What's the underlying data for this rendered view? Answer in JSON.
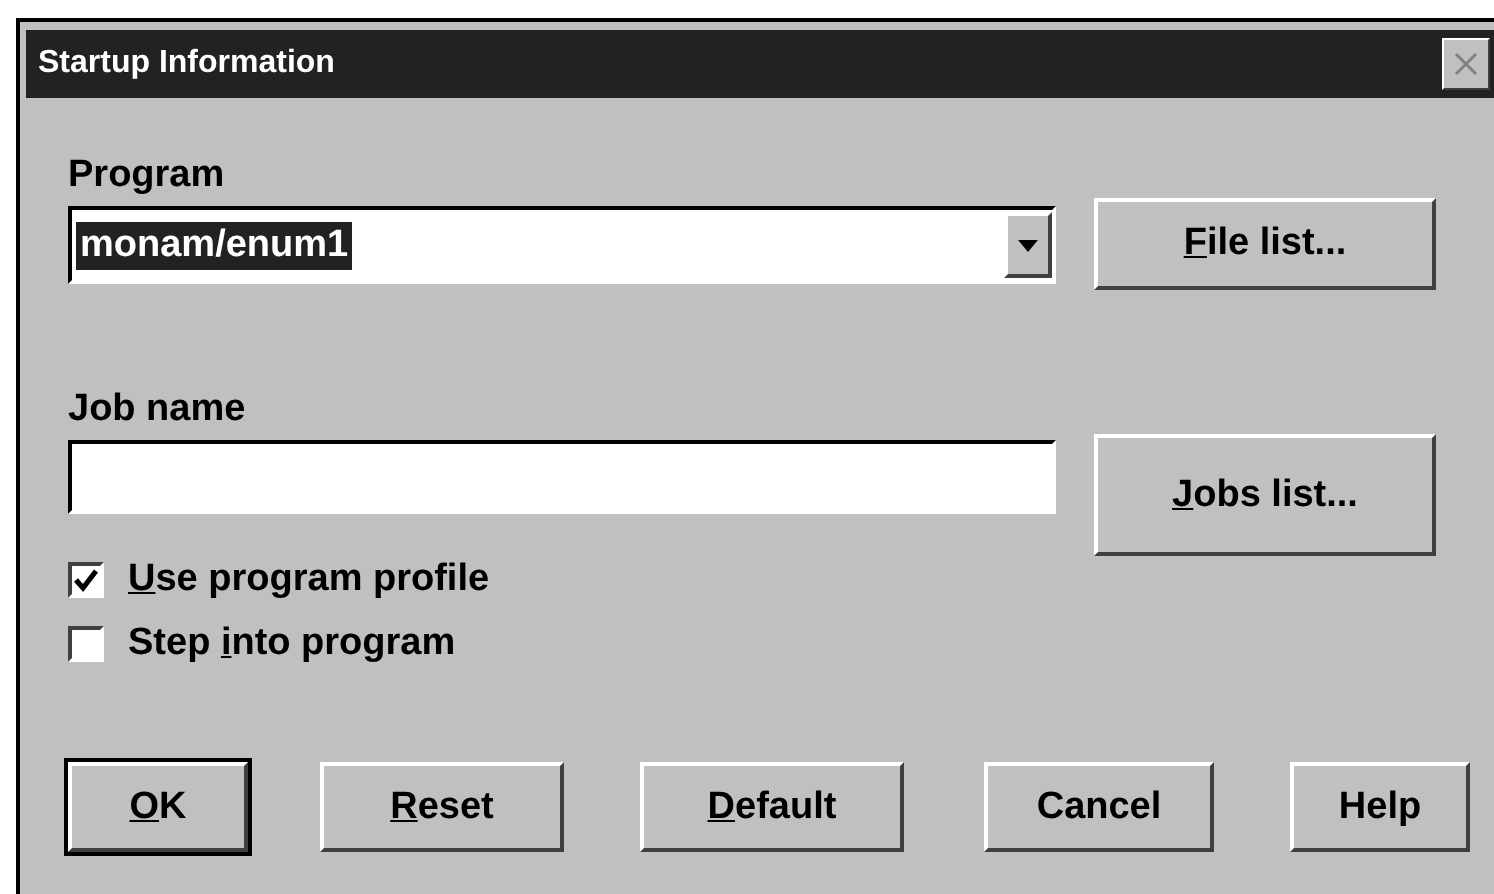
{
  "window": {
    "title": "Startup Information"
  },
  "program": {
    "label": "Program",
    "value": "monam/enum1",
    "value_selected": true
  },
  "file_list_button": {
    "mnemonic": "F",
    "label_rest": "ile list..."
  },
  "job_name": {
    "label": "Job name"
  },
  "jobs_list_button": {
    "mnemonic": "J",
    "label_rest": "obs list..."
  },
  "checkboxes": [
    {
      "mnemonic": "U",
      "label_rest": "se program profile",
      "checked": true
    },
    {
      "label_start": "Step ",
      "mnemonic": "i",
      "label_rest": "nto program",
      "checked": false
    }
  ],
  "buttons": [
    {
      "mnemonic": "O",
      "label_rest": "K",
      "default": true
    },
    {
      "mnemonic": "R",
      "label_rest": "eset",
      "default": false
    },
    {
      "mnemonic": "D",
      "label_rest": "efault",
      "default": false
    },
    {
      "label_rest": "Cancel",
      "default": false
    },
    {
      "label_rest": "Help",
      "default": false
    }
  ]
}
